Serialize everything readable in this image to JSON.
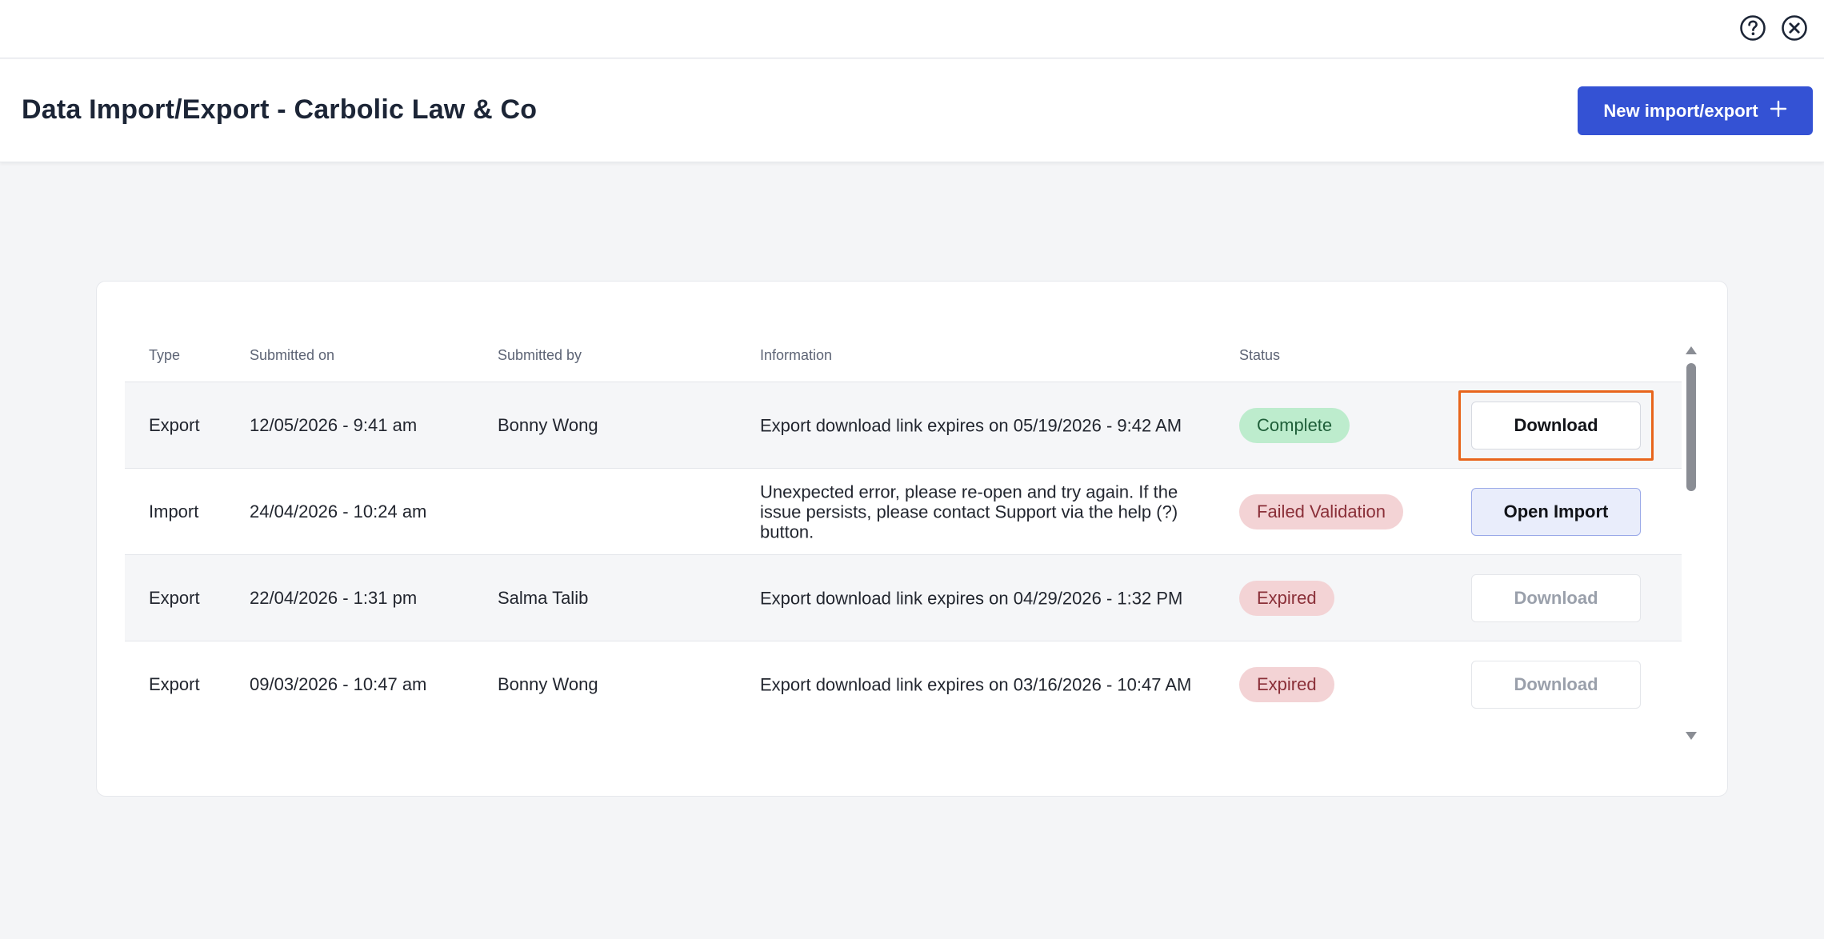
{
  "page": {
    "title": "Data Import/Export - Carbolic Law & Co",
    "new_button_label": "New import/export"
  },
  "icons": {
    "help": "help-circle-icon",
    "close": "close-circle-icon",
    "plus": "plus-icon"
  },
  "colors": {
    "primary": "#3452d4",
    "complete_bg": "#bdeccd",
    "complete_text": "#1f5f39",
    "failed_bg": "#f3d3d5",
    "failed_text": "#8a2f38",
    "expired_bg": "#f3d3d5",
    "expired_text": "#8a2f38",
    "highlight": "#e8651c"
  },
  "table": {
    "headers": {
      "type": "Type",
      "submitted_on": "Submitted on",
      "submitted_by": "Submitted by",
      "information": "Information",
      "status": "Status"
    },
    "rows": [
      {
        "type": "Export",
        "submitted_on": "12/05/2026 - 9:41 am",
        "submitted_by": "Bonny Wong",
        "information": "Export download link expires on 05/19/2026 - 9:42 AM",
        "status": "Complete",
        "action": "Download",
        "action_state": "enabled"
      },
      {
        "type": "Import",
        "submitted_on": "24/04/2026 - 10:24 am",
        "submitted_by": "",
        "information": "Unexpected error, please re-open and try again. If the issue persists, please contact Support via the help (?) button.",
        "status": "Failed Validation",
        "action": "Open Import",
        "action_state": "enabled"
      },
      {
        "type": "Export",
        "submitted_on": "22/04/2026 - 1:31 pm",
        "submitted_by": "Salma Talib",
        "information": "Export download link expires on 04/29/2026 - 1:32 PM",
        "status": "Expired",
        "action": "Download",
        "action_state": "disabled"
      },
      {
        "type": "Export",
        "submitted_on": "09/03/2026 - 10:47 am",
        "submitted_by": "Bonny Wong",
        "information": "Export download link expires on 03/16/2026 - 10:47 AM",
        "status": "Expired",
        "action": "Download",
        "action_state": "disabled"
      }
    ]
  }
}
